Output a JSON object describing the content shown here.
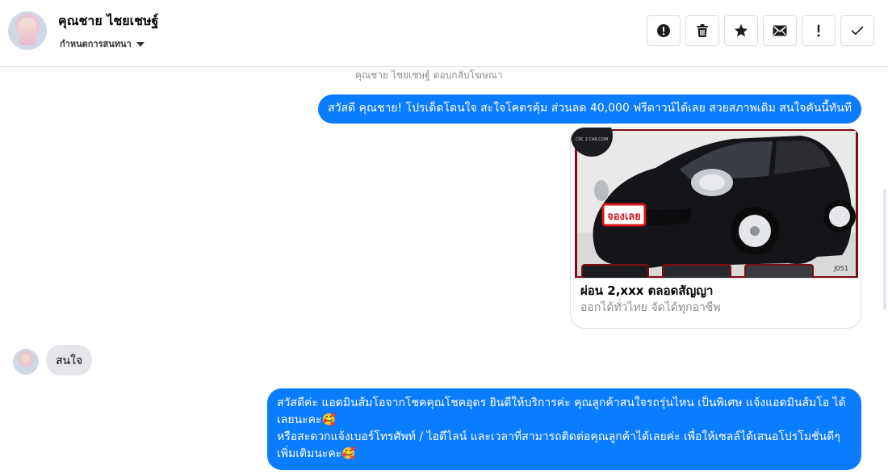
{
  "header": {
    "contact_name": "คุณชาย ไชยเชษฐ์",
    "assign_label": "กำหนดการสนทนา"
  },
  "toolbar": {
    "buttons": [
      "spam-icon",
      "trash-icon",
      "star-icon",
      "envelope-icon",
      "exclamation-icon",
      "check-icon"
    ]
  },
  "thread": {
    "reply_note": "คุณชาย ไชยเชษฐ์ ตอบกลับโฆษณา",
    "outgoing_1": "สวัสดี คุณชาย! โปรเด็ดโดนใจ สะใจโคตรคุ้ม ส่วนลด 40,000 ฟรีดาวน์ได้เลย สวยสภาพเดิม สนใจคันนี้ทันที",
    "ad_card": {
      "badge_text": "จองเลย",
      "logo_text": "CRC 2 CAR.COM",
      "code_text": "J051",
      "title": "ผ่อน 2,xxx ตลอดสัญญา",
      "subtitle": "ออกได้ทั่วไทย จัดได้ทุกอาชีพ"
    },
    "incoming_1": "สนใจ",
    "outgoing_2_line1": "สวัสดีค่ะ แอดมินส้มโอจากโชคคุณโชคอุดร ยินดีให้บริการค่ะ   คุณลูกค้าสนใจรถรุ่นไหน เป็นพิเศษ แจ้งแอดมินส้มโอ ได้เลยนะคะ🥰",
    "outgoing_2_line2": "หรือสะดวกแจ้งเบอร์โทรศัพท์ / ไอดีไลน์ และเวลาที่สามารถติดต่อคุณลูกค้าได้เลยค่ะ เพื่อให้เซลล์ได้เสนอโปรโมชั่นดีๆเพิ่มเติมนะคะ🥰"
  },
  "colors": {
    "outgoing_bubble": "#0a7cff",
    "incoming_bubble": "#e4e6eb",
    "badge_red": "#d8141c"
  }
}
